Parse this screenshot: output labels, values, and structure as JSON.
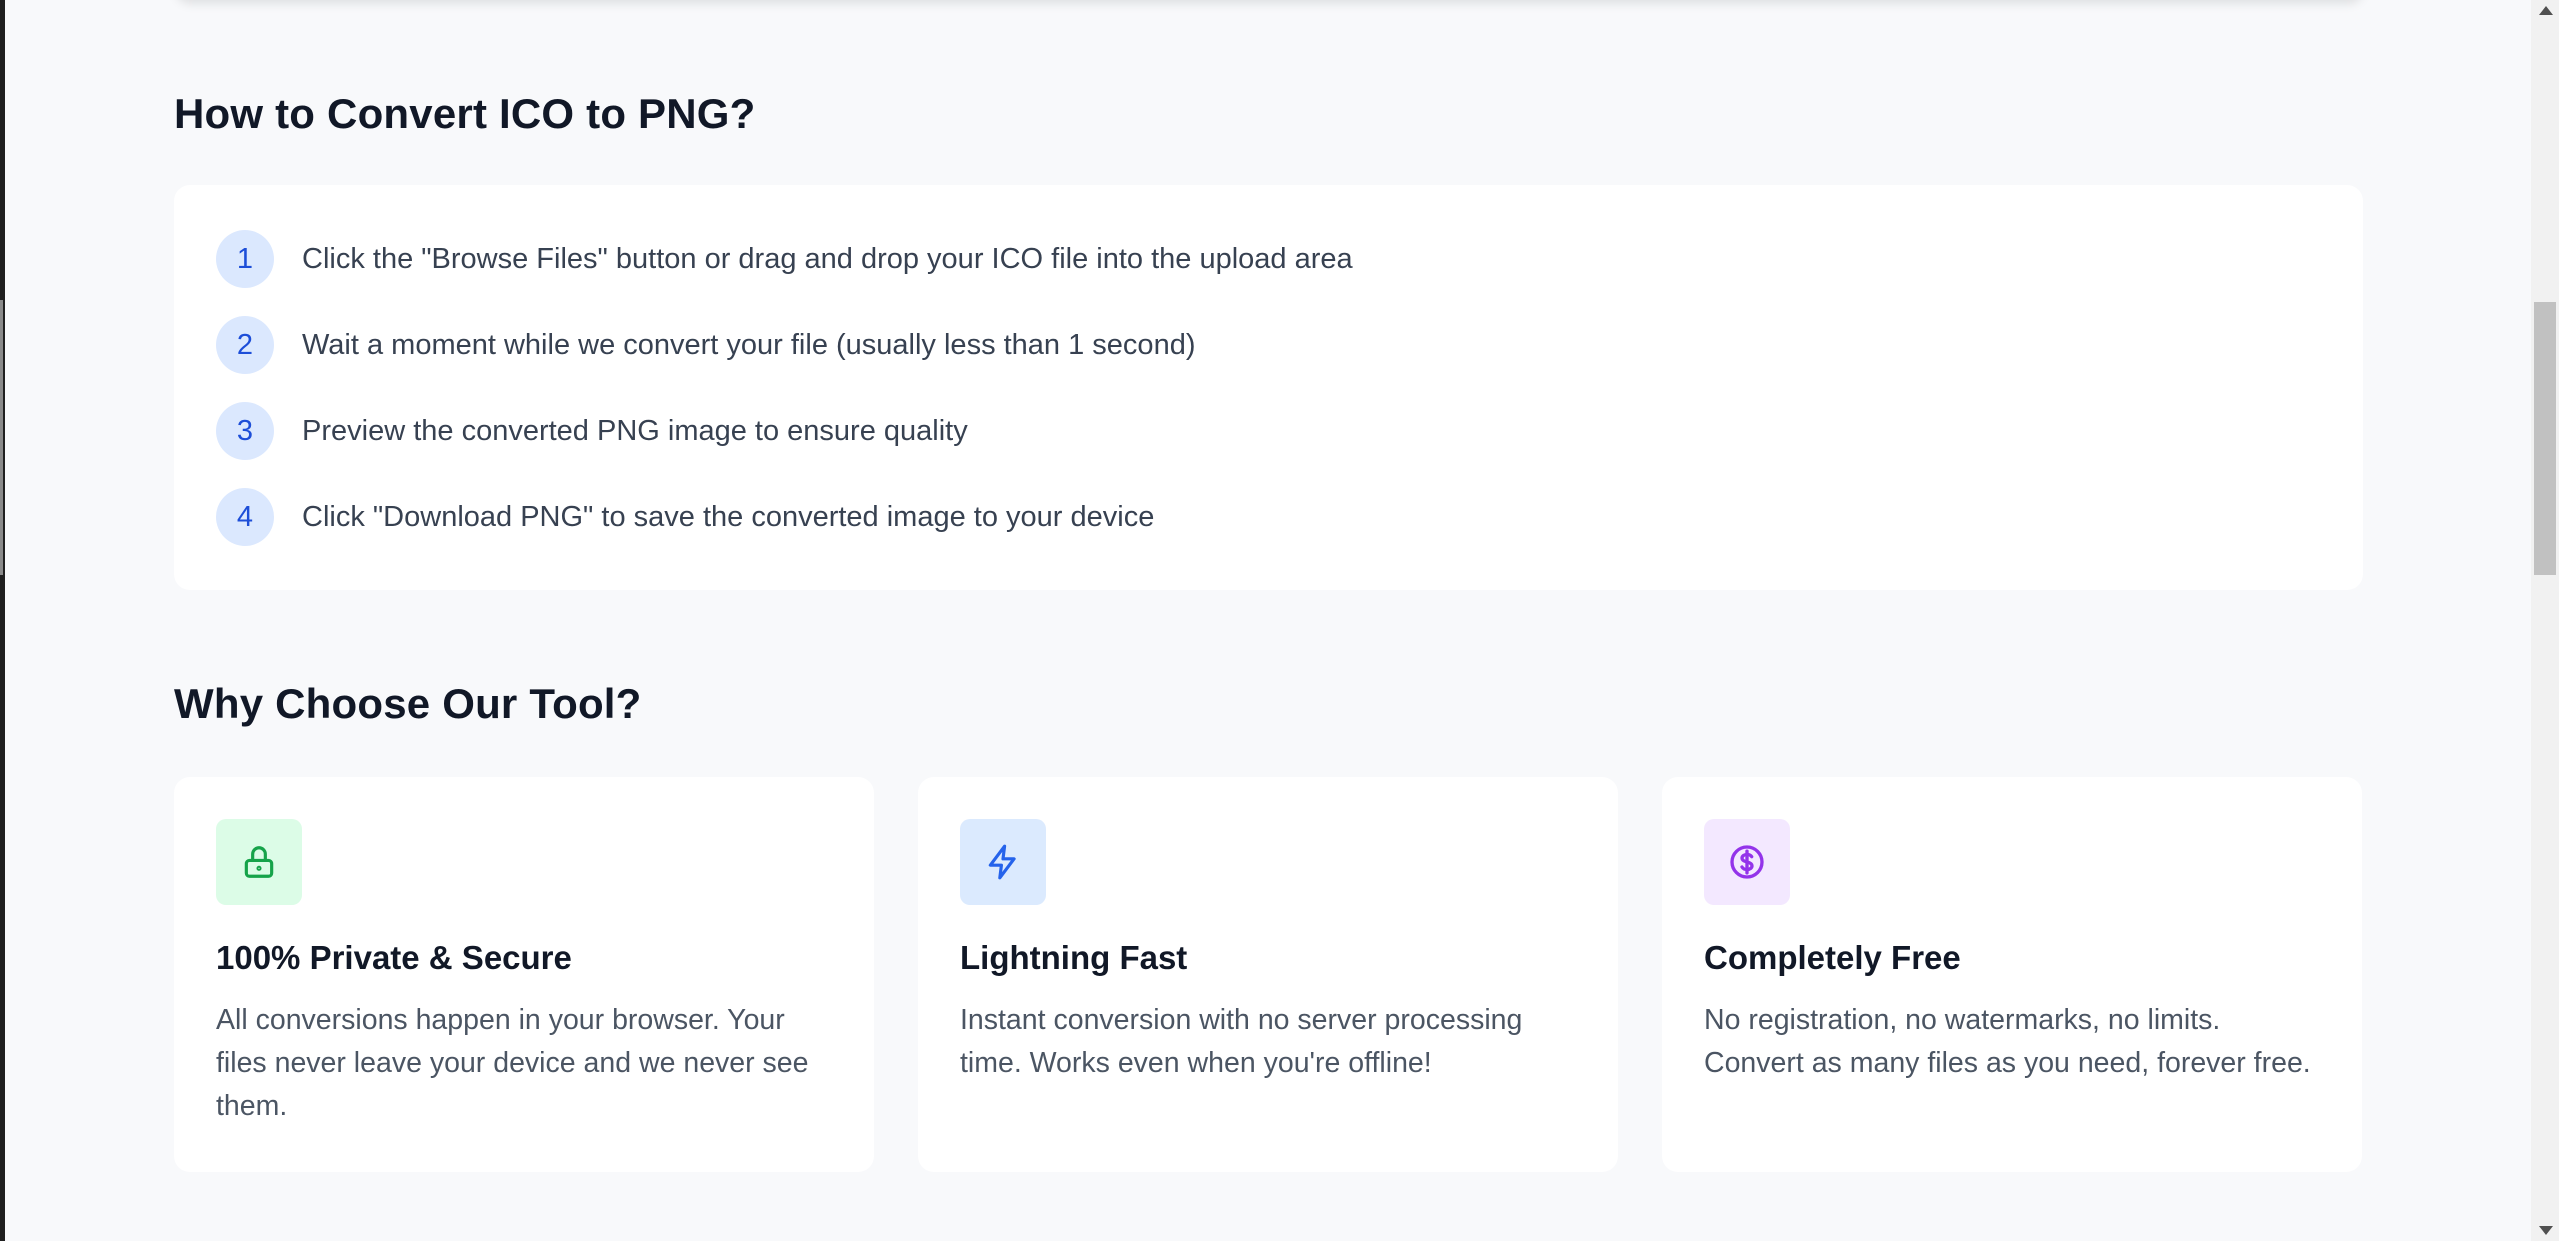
{
  "how_to": {
    "title": "How to Convert ICO to PNG?",
    "steps": [
      {
        "number": "1",
        "text": "Click the \"Browse Files\" button or drag and drop your ICO file into the upload area"
      },
      {
        "number": "2",
        "text": "Wait a moment while we convert your file (usually less than 1 second)"
      },
      {
        "number": "3",
        "text": "Preview the converted PNG image to ensure quality"
      },
      {
        "number": "4",
        "text": "Click \"Download PNG\" to save the converted image to your device"
      }
    ]
  },
  "why": {
    "title": "Why Choose Our Tool?",
    "features": [
      {
        "icon": "lock-icon",
        "title": "100% Private & Secure",
        "description": "All conversions happen in your browser. Your files never leave your device and we never see them.",
        "icon_color": "#16a34a",
        "icon_bg": "#dcfce7"
      },
      {
        "icon": "lightning-icon",
        "title": "Lightning Fast",
        "description": "Instant conversion with no server processing time. Works even when you're offline!",
        "icon_color": "#2563eb",
        "icon_bg": "#dbeafe"
      },
      {
        "icon": "dollar-circle-icon",
        "title": "Completely Free",
        "description": "No registration, no watermarks, no limits. Convert as many files as you need, forever free.",
        "icon_color": "#9333ea",
        "icon_bg": "#f3e8ff"
      }
    ]
  },
  "colors": {
    "page_bg": "#f8f9fb",
    "step_badge_bg": "#dbe8fe",
    "step_badge_text": "#1d4ed8"
  }
}
